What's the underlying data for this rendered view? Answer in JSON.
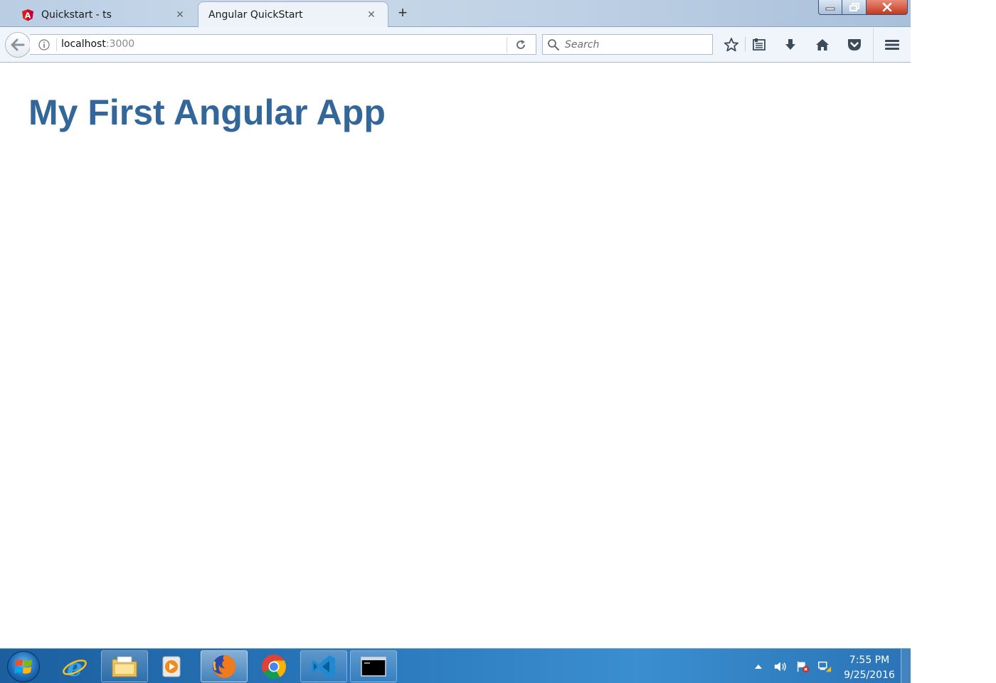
{
  "browser": {
    "tabs": [
      {
        "label": "Quickstart - ts",
        "active": false,
        "favicon": "angular-icon"
      },
      {
        "label": "Angular QuickStart",
        "active": true
      }
    ],
    "address_bar": {
      "host": "localhost",
      "port": ":3000"
    },
    "search": {
      "placeholder": "Search"
    },
    "icons": {
      "back": "back-arrow-icon",
      "info": "info-icon",
      "reload": "reload-icon",
      "bookmark_star": "star-icon",
      "bookmarks_menu": "bookmarks-list-icon",
      "downloads": "download-arrow-icon",
      "home": "home-icon",
      "pocket": "pocket-icon",
      "menu": "hamburger-menu-icon"
    }
  },
  "page": {
    "heading": "My First Angular App",
    "heading_color": "#336699"
  },
  "taskbar": {
    "apps": [
      {
        "name": "internet-explorer-icon",
        "state": "pinned"
      },
      {
        "name": "file-explorer-icon",
        "state": "open"
      },
      {
        "name": "media-player-icon",
        "state": "pinned"
      },
      {
        "name": "firefox-icon",
        "state": "active"
      },
      {
        "name": "chrome-icon",
        "state": "pinned"
      },
      {
        "name": "visual-studio-code-icon",
        "state": "open"
      },
      {
        "name": "command-prompt-icon",
        "state": "open"
      }
    ],
    "clock": {
      "time": "7:55 PM",
      "date": "9/25/2016"
    }
  }
}
